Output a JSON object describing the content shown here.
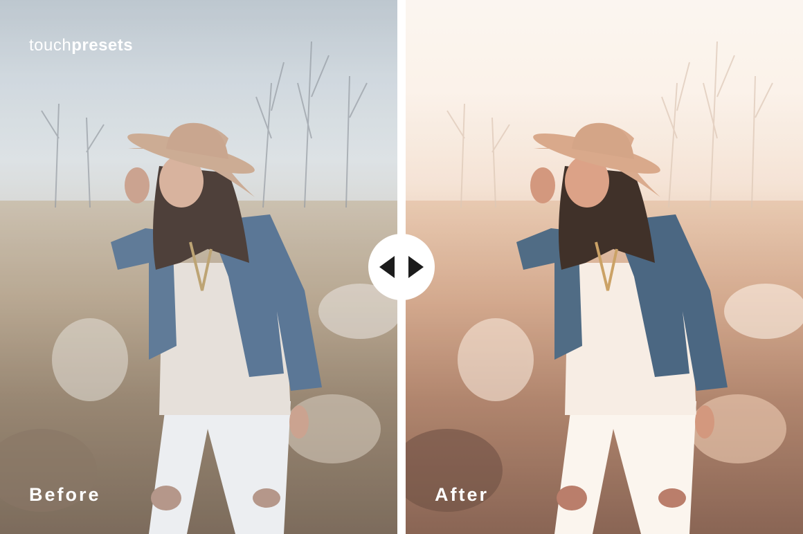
{
  "brand": {
    "light": "touch",
    "bold": "presets"
  },
  "labels": {
    "before": "Before",
    "after": "After"
  },
  "compare_handle": {
    "icon": "left-right-arrows-icon"
  },
  "colors": {
    "text": "#ffffff",
    "before_tone": "#c9bca8",
    "after_tone": "#e6c6ad"
  }
}
